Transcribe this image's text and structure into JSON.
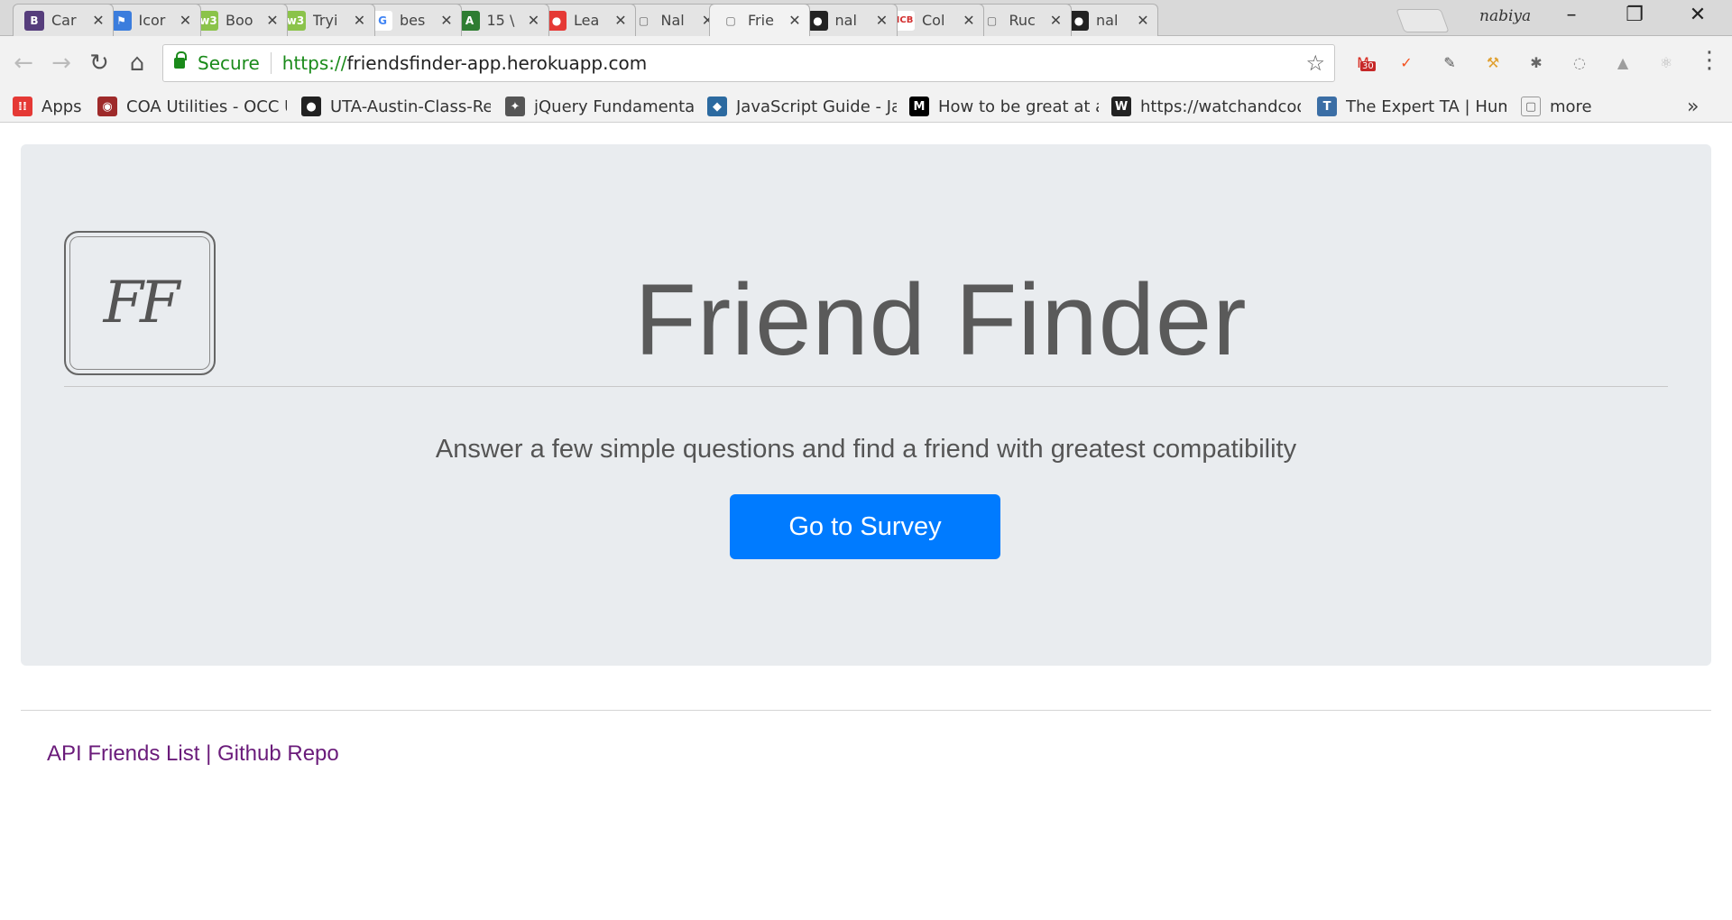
{
  "browser": {
    "tabs": [
      {
        "title": "Car",
        "icon": "bootstrap-icon",
        "icon_color": "#563d7c",
        "glyph": "B"
      },
      {
        "title": "Icor",
        "icon": "flag-icon",
        "icon_color": "#3b7ddd",
        "glyph": "⚑"
      },
      {
        "title": "Boo",
        "icon": "w3schools-icon",
        "icon_color": "#8bc34a",
        "glyph": "w3"
      },
      {
        "title": "Tryi",
        "icon": "w3schools-icon",
        "icon_color": "#8bc34a",
        "glyph": "w3"
      },
      {
        "title": "bes",
        "icon": "google-icon",
        "icon_color": "#ffffff",
        "glyph": "G"
      },
      {
        "title": "15 \\",
        "icon": "spreadsheet-icon",
        "icon_color": "#2e7d32",
        "glyph": "A"
      },
      {
        "title": "Lea",
        "icon": "ball-icon",
        "icon_color": "#e53935",
        "glyph": "●"
      },
      {
        "title": "Nal",
        "icon": "page-icon",
        "icon_color": "#e4e4e4",
        "glyph": "▢"
      },
      {
        "title": "Frie",
        "icon": "page-icon",
        "icon_color": "#f2f2f2",
        "glyph": "▢"
      },
      {
        "title": "nal",
        "icon": "github-icon",
        "icon_color": "#222222",
        "glyph": "●"
      },
      {
        "title": "Col",
        "icon": "icb-icon",
        "icon_color": "#ffffff",
        "glyph": "ICB"
      },
      {
        "title": "Ruc",
        "icon": "page-icon",
        "icon_color": "#e4e4e4",
        "glyph": "▢"
      },
      {
        "title": "nal",
        "icon": "github-icon",
        "icon_color": "#222222",
        "glyph": "●"
      }
    ],
    "active_tab_index": 8,
    "profile_name": "nabiya",
    "address": {
      "secure_label": "Secure",
      "scheme": "https://",
      "host": "friendsfinder-app.herokuapp.com"
    },
    "extensions": [
      {
        "name": "gmail-icon",
        "color": "#d93025",
        "glyph": "M",
        "badge": "30"
      },
      {
        "name": "compass-icon",
        "color": "#f4511e",
        "glyph": "✓"
      },
      {
        "name": "eyedropper-icon",
        "color": "#555555",
        "glyph": "✎"
      },
      {
        "name": "hammer-icon",
        "color": "#e0a030",
        "glyph": "⚒"
      },
      {
        "name": "bug-icon",
        "color": "#666666",
        "glyph": "✱"
      },
      {
        "name": "code-icon",
        "color": "#888888",
        "glyph": "◌"
      },
      {
        "name": "drive-icon",
        "color": "#9e9e9e",
        "glyph": "▲"
      },
      {
        "name": "react-icon",
        "color": "#bbbbbb",
        "glyph": "⚛"
      }
    ],
    "bookmarks": [
      {
        "label": "Apps",
        "icon": "apps-grid-icon",
        "color": "#e53935",
        "glyph": "⁞⁞"
      },
      {
        "label": "COA Utilities - OCC U",
        "icon": "coa-icon",
        "color": "#9e2a2a",
        "glyph": "◉"
      },
      {
        "label": "UTA-Austin-Class-Rep",
        "icon": "github-icon",
        "color": "#222222",
        "glyph": "●"
      },
      {
        "label": "jQuery Fundamentals",
        "icon": "rooster-icon",
        "color": "#555555",
        "glyph": "✦"
      },
      {
        "label": "JavaScript Guide - Jav",
        "icon": "mdn-icon",
        "color": "#2c6aa0",
        "glyph": "◆"
      },
      {
        "label": "How to be great at as",
        "icon": "medium-icon",
        "color": "#000000",
        "glyph": "M"
      },
      {
        "label": "https://watchandcode",
        "icon": "watchandcode-icon",
        "color": "#222222",
        "glyph": "W"
      },
      {
        "label": "The Expert TA | Huma",
        "icon": "expert-ta-icon",
        "color": "#3b6ea5",
        "glyph": "T"
      },
      {
        "label": "more",
        "icon": "folder-page-icon",
        "color": "#f2f2f2",
        "glyph": "▢"
      }
    ]
  },
  "page": {
    "logo_text": "FF",
    "title": "Friend Finder",
    "lead": "Answer a few simple questions and find a friend with greatest compatibility",
    "survey_button": "Go to Survey",
    "footer": {
      "api_link": "API Friends List",
      "separator": "|",
      "github_link": "Github Repo"
    }
  }
}
